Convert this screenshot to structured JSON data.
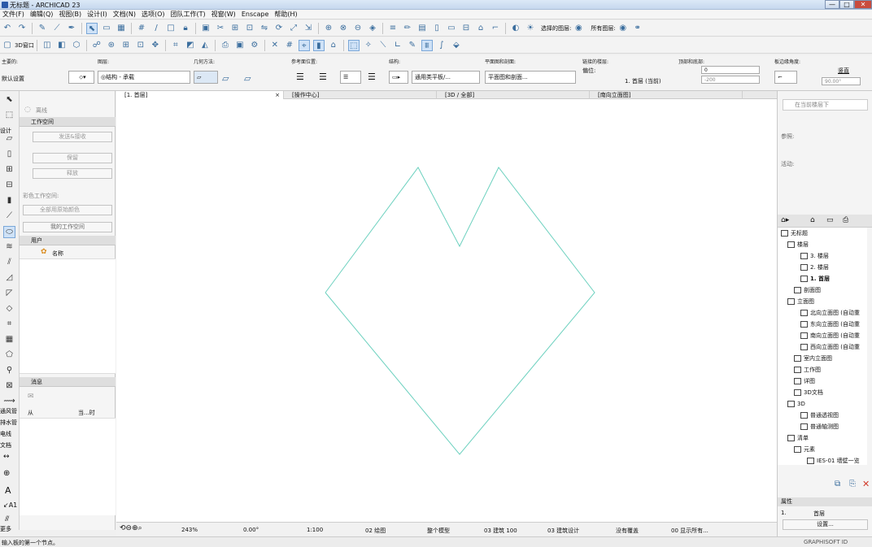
{
  "window": {
    "title": "无标题 - ARCHICAD 23",
    "min": "—",
    "max": "□",
    "close": "✕"
  },
  "menu": [
    "文件(F)",
    "编辑(Q)",
    "视图(B)",
    "设计(I)",
    "文档(N)",
    "选项(O)",
    "团队工作(T)",
    "视窗(W)",
    "Enscape",
    "帮助(H)"
  ],
  "toolbar2": {
    "selected_graphic": "选择的图层:",
    "all_layers": "所有图层:"
  },
  "toolbar3": {
    "threed_window": "3D窗口"
  },
  "infobox": {
    "main_label": "主要的:",
    "main_value": "默认设置",
    "layer_label": "图层:",
    "layer_value": "◎结构 - 承载",
    "geom_label": "几何方法:",
    "ref_label": "参考面位置:",
    "struct_label": "结构:",
    "struct_value": "通用类平板/...",
    "floorplan_label": "平面图和剖面:",
    "floorplan_value": "平面图和剖面...",
    "story_label": "链接的楼层:",
    "story_sub": "偏位:",
    "story_value": "1. 首层 (当前)",
    "topbot_label": "顶部和底部:",
    "top_value": "0",
    "bot_value": "-200",
    "edge_label": "板边缘角度:",
    "edge_type": "竖直",
    "edge_angle": "90.00°"
  },
  "tabs": [
    {
      "label": "[1. 首层]"
    },
    {
      "label": "[操作中心]"
    },
    {
      "label": "[3D / 全部]"
    },
    {
      "label": "[南向立面图]"
    }
  ],
  "tools": [
    "箭头",
    "选框",
    "设计",
    "墙",
    "门",
    "窗",
    "物体",
    "柱",
    "梁",
    "板",
    "屋顶",
    "壳",
    "网面",
    "变形体",
    "幕墙",
    "楼梯",
    "栏杆",
    "通风管",
    "排水管",
    "电线",
    "文档",
    "标注",
    "A",
    "A1",
    "更多"
  ],
  "tool_labels": {
    "design": "设计",
    "duct": "通风管",
    "pipe": "排水管",
    "wire": "电线",
    "doc": "文档",
    "more": "更多"
  },
  "navigator": {
    "offline": "离线",
    "workspace_hdr": "工作空间",
    "send_receive": "发送&接收",
    "keep": "保留",
    "release": "释放",
    "color_label": "彩色工作空间:",
    "color_value": "全部用原始颜色",
    "my_workspace": "我的工作空间",
    "users_hdr": "用户",
    "name_label": "名称",
    "messages_hdr": "消息",
    "from_label": "从",
    "time_label": "当...时"
  },
  "status": {
    "zoom": "243%",
    "angle": "0.00°",
    "scale": "1:100",
    "pen": "02 绘图",
    "model": "整个模型",
    "struct": "03 建筑 100",
    "design": "03 建筑设计",
    "override": "没有覆盖",
    "show": "00 显示所有..."
  },
  "bottom": {
    "prompt": "输入板的第一个节点。",
    "brand": "GRAPHISOFT ID"
  },
  "right": {
    "current_story": "在当前楼层下",
    "ref_label": "参照:",
    "active_label": "活动:",
    "tree": [
      "无标题",
      "楼层",
      "3. 楼层",
      "2. 楼层",
      "1. 首层",
      "剖面图",
      "立面图",
      "北向立面图 (自动重",
      "东向立面图 (自动重",
      "南向立面图 (自动重",
      "西向立面图 (自动重",
      "室内立面图",
      "工作图",
      "详图",
      "3D文档",
      "3D",
      "普通透视图",
      "普通轴测图",
      "清单",
      "元素",
      "IES-01 墙壁一览"
    ],
    "props_hdr": "属性",
    "props_num": "1.",
    "props_name": "首层",
    "settings": "设置..."
  },
  "colors": {
    "shape": "#6dd1bf",
    "accent": "#3b6e9e"
  }
}
